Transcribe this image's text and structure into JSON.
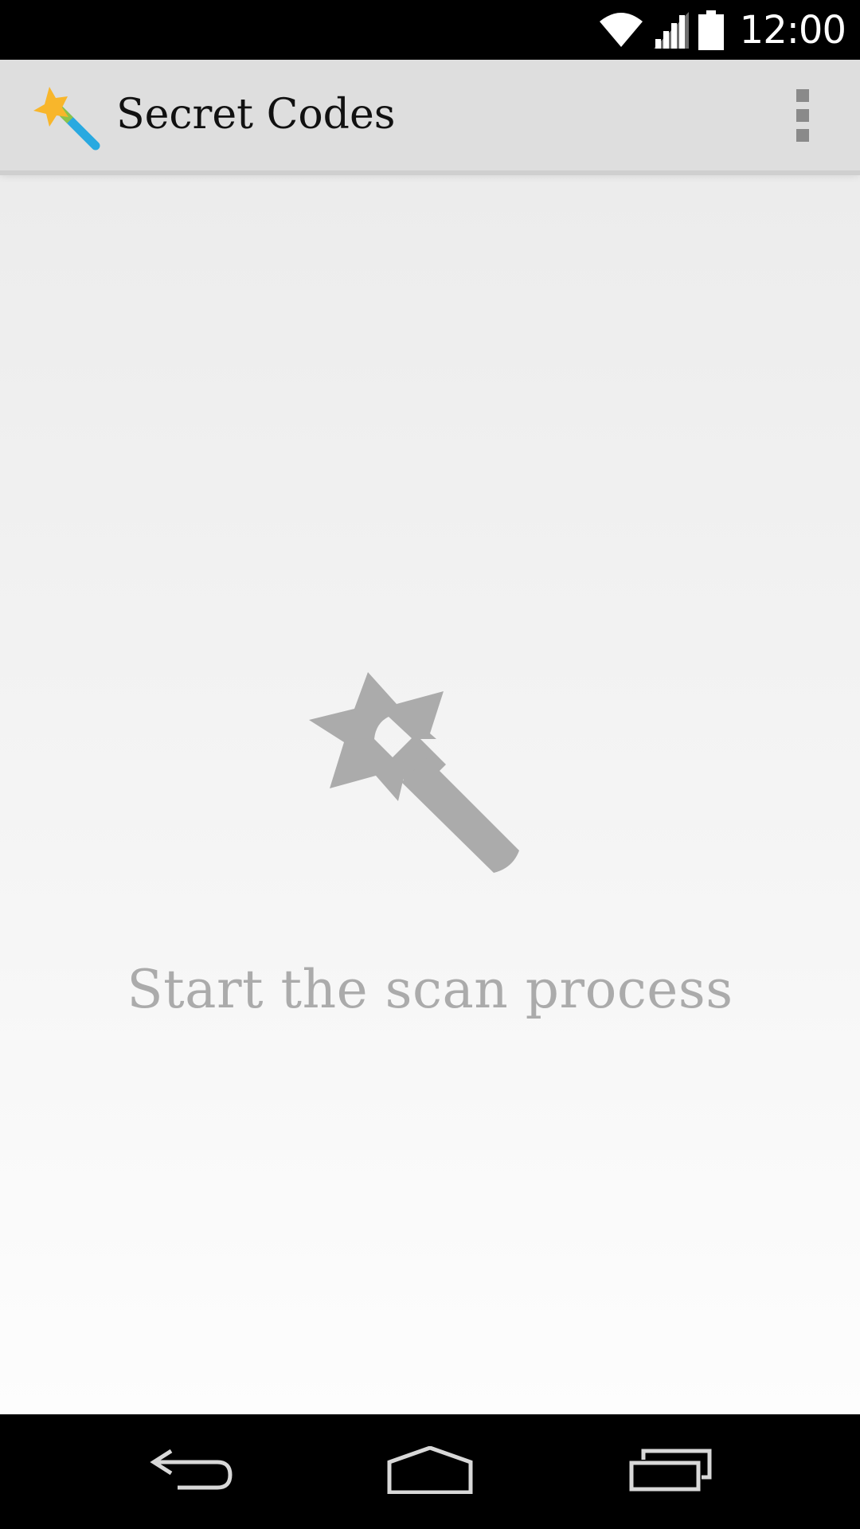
{
  "status_bar": {
    "time": "12:00",
    "icons": [
      "wifi-icon",
      "cell-signal-icon",
      "battery-icon"
    ]
  },
  "action_bar": {
    "title": "Secret Codes",
    "app_icon": "magic-wand-icon",
    "menu_icon": "overflow-menu-icon"
  },
  "main": {
    "empty_icon": "magic-wand-icon",
    "empty_text": "Start the scan process"
  },
  "nav_bar": {
    "buttons": [
      "back-icon",
      "home-icon",
      "recents-icon"
    ]
  },
  "colors": {
    "action_bar_bg": "#dedede",
    "empty_state_gray": "#ababab",
    "star_yellow": "#f8b62b",
    "wand_green": "#8bc34a",
    "wand_blue": "#29a9e0"
  }
}
